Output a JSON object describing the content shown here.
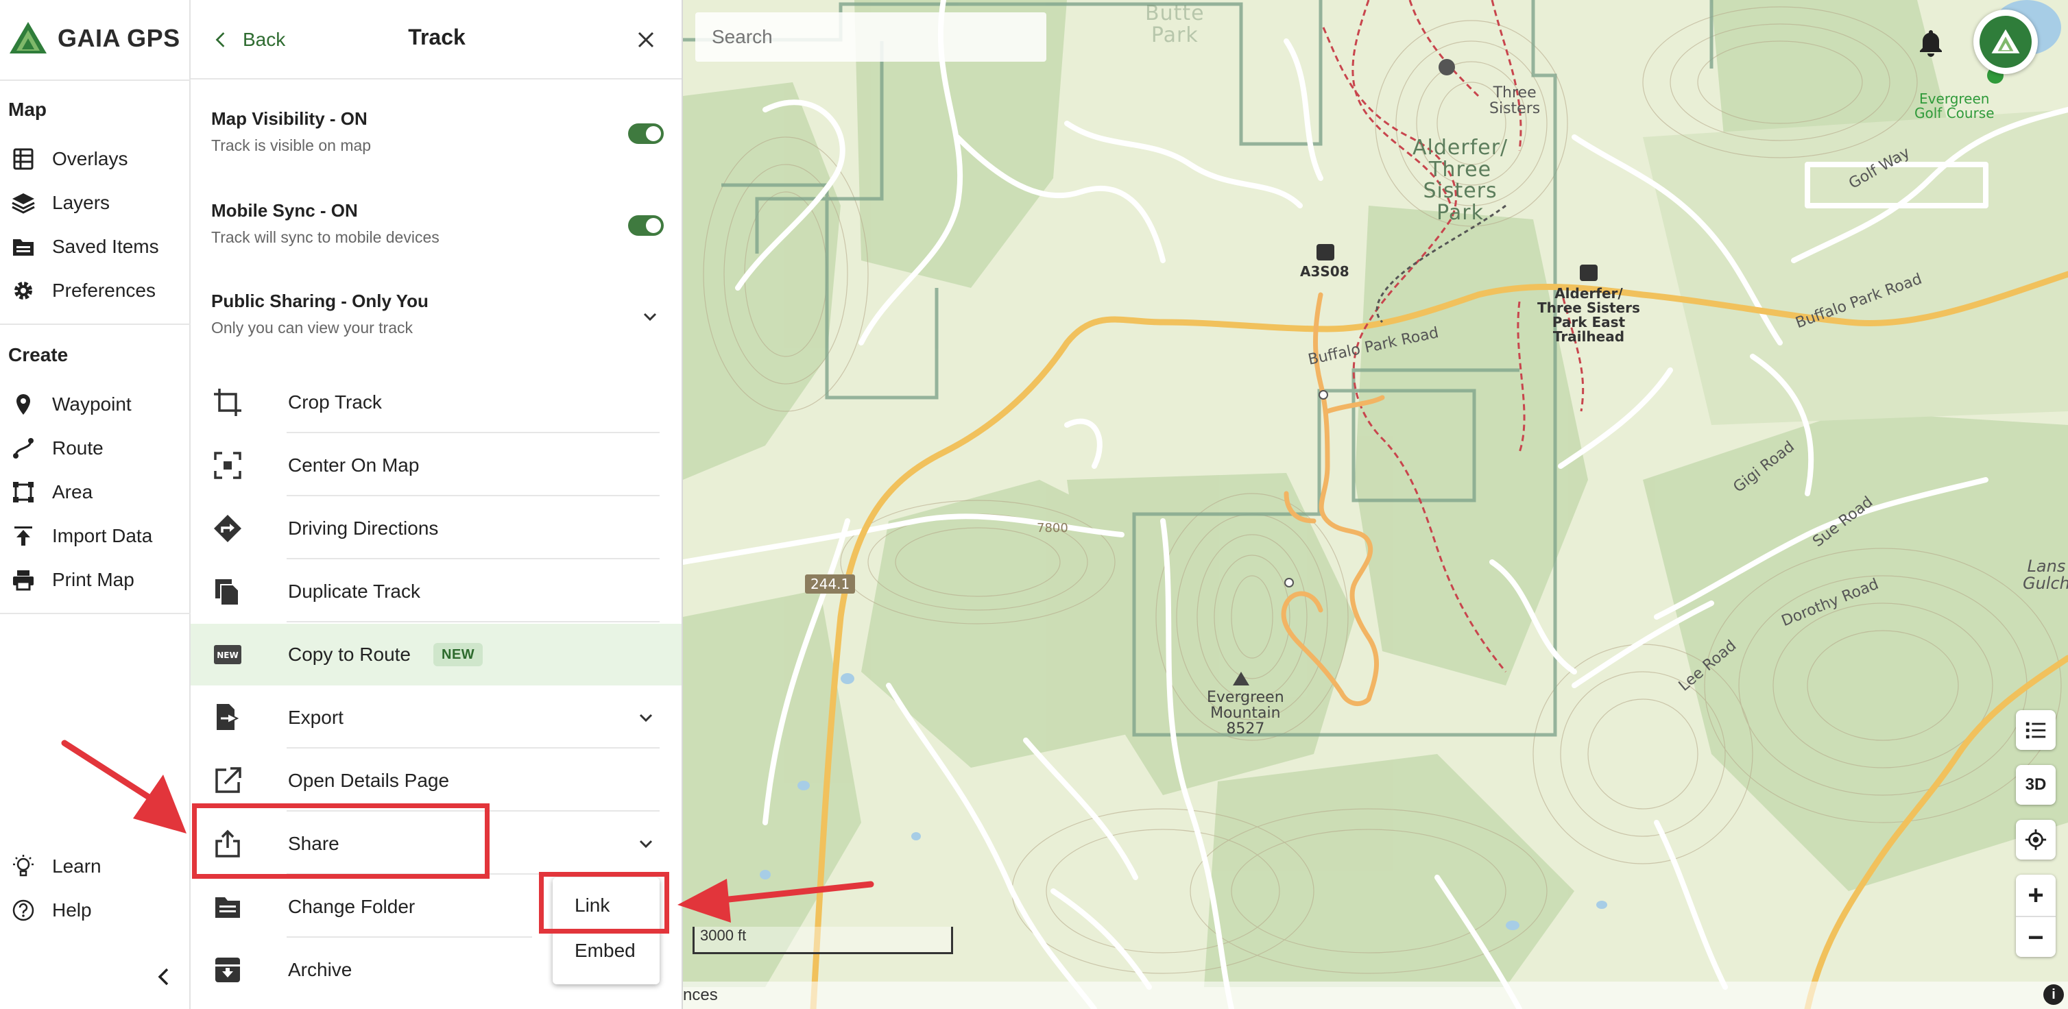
{
  "app": {
    "brand": "GAIA GPS"
  },
  "nav": {
    "map_heading": "Map",
    "map_items": [
      "Overlays",
      "Layers",
      "Saved Items",
      "Preferences"
    ],
    "create_heading": "Create",
    "create_items": [
      "Waypoint",
      "Route",
      "Area",
      "Import Data",
      "Print Map"
    ],
    "bottom_items": [
      "Learn",
      "Help"
    ]
  },
  "panel": {
    "back_label": "Back",
    "title": "Track",
    "map_visibility": {
      "title": "Map Visibility - ON",
      "subtitle": "Track is visible on map",
      "on": true
    },
    "mobile_sync": {
      "title": "Mobile Sync - ON",
      "subtitle": "Track will sync to mobile devices",
      "on": true
    },
    "public_sharing": {
      "title": "Public Sharing - Only You",
      "subtitle": "Only you can view your track"
    },
    "actions": [
      "Crop Track",
      "Center On Map",
      "Driving Directions",
      "Duplicate Track",
      "Copy to Route",
      "Export",
      "Open Details Page",
      "Share",
      "Change Folder",
      "Archive"
    ],
    "new_badge": "NEW"
  },
  "share_menu": {
    "options": [
      "Link",
      "Embed"
    ]
  },
  "map": {
    "search_placeholder": "Search",
    "labels": {
      "park": "Alderfer/\nThree\nSisters\nPark",
      "three_sisters": "Three\nSisters",
      "th_a3s08": "A3S08",
      "th_east": "Alderfer/\nThree Sisters\nPark East\nTrailhead",
      "road_buffalo_1": "Buffalo Park Road",
      "road_buffalo_2": "Buffalo Park Road",
      "mountain": "Evergreen\nMountain\n8527",
      "golf": "Evergreen\nGolf Course",
      "butte": "Butte\nPark",
      "gigi": "Gigi Road",
      "sue": "Sue Road",
      "dorothy": "Dorothy Road",
      "lee": "Lee Road",
      "golf_way": "Golf Way",
      "lans": "Lans\nGulch",
      "elev": "7800"
    },
    "route_shield": "244.1",
    "button_3d": "3D",
    "zoom_in": "+",
    "zoom_out": "−",
    "scale": "3000 ft",
    "attribution": "nces",
    "info": "i"
  },
  "colors": {
    "accent": "#2e6b30",
    "toggle": "#3f7a3f",
    "annotation": "#e2353b",
    "track": "#f2b463"
  }
}
